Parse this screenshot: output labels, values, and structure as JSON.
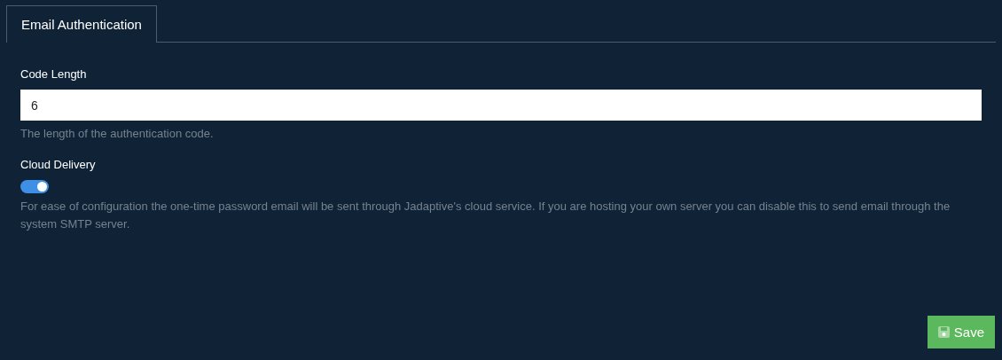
{
  "tabs": [
    {
      "label": "Email Authentication",
      "selected": true
    }
  ],
  "fields": [
    {
      "kind": "text",
      "label": "Code Length",
      "value": "6",
      "help": "The length of the authentication code."
    },
    {
      "kind": "toggle",
      "label": "Cloud Delivery",
      "on": true,
      "help": "For ease of configuration the one-time password email will be sent through Jadaptive's cloud service. If you are hosting your own server you can disable this to send email through the system SMTP server."
    }
  ],
  "buttons": [
    {
      "label": "Save"
    }
  ]
}
